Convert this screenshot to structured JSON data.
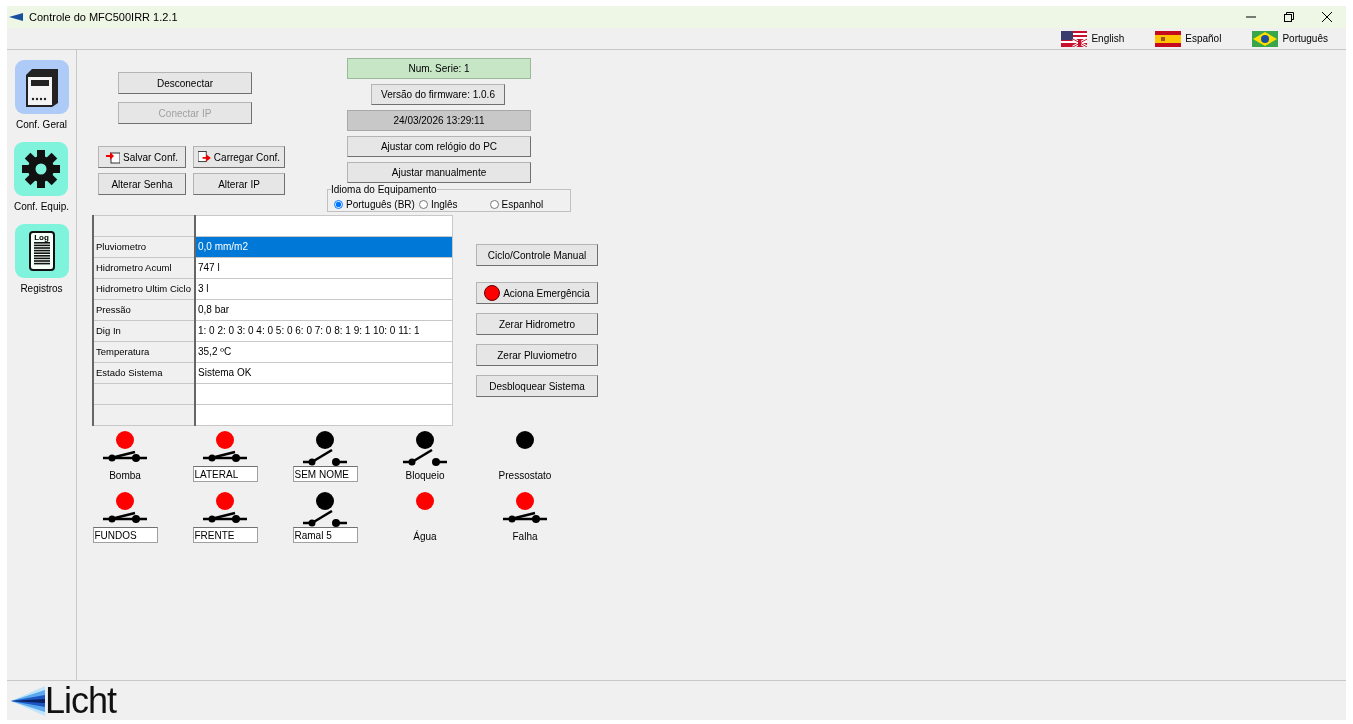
{
  "window": {
    "title": "Controle do MFC500IRR  1.2.1"
  },
  "languages": [
    {
      "kind": "us-uk",
      "label": "English"
    },
    {
      "kind": "es",
      "label": "Español"
    },
    {
      "kind": "br",
      "label": "Português"
    }
  ],
  "sidebar": {
    "items": [
      {
        "kind": "device",
        "label": "Conf. Geral",
        "selected": true
      },
      {
        "kind": "gear",
        "label": "Conf. Equip.",
        "selected": false
      },
      {
        "kind": "log",
        "label": "Registros",
        "selected": false,
        "icon_text": "Log"
      }
    ]
  },
  "connection_buttons": [
    {
      "label": "Desconectar",
      "disabled": false
    },
    {
      "label": "Conectar IP",
      "disabled": true
    }
  ],
  "config_buttons": [
    {
      "label": "Salvar Conf.",
      "kind": "save"
    },
    {
      "label": "Carregar Conf.",
      "kind": "load"
    },
    {
      "label": "Alterar Senha",
      "kind": "plain"
    },
    {
      "label": "Alterar IP",
      "kind": "plain"
    }
  ],
  "device_info": [
    {
      "kind": "serial",
      "text": "Num. Serie: 1"
    },
    {
      "kind": "firmware",
      "text": "Versão do firmware: 1.0.6"
    },
    {
      "kind": "clock",
      "text": "24/03/2026 13:29:11"
    },
    {
      "kind": "button",
      "text": "Ajustar com relógio do PC"
    },
    {
      "kind": "button",
      "text": "Ajustar manualmente"
    }
  ],
  "equipment_language": {
    "title": "Idioma do Equipamento",
    "options": [
      {
        "label": "Português (BR)",
        "selected": true
      },
      {
        "label": "Inglês",
        "selected": false
      },
      {
        "label": "Espanhol",
        "selected": false
      }
    ]
  },
  "table": {
    "rows": [
      {
        "name": "Pluviometro",
        "value": "0,0 mm/m2",
        "selected": true
      },
      {
        "name": "Hidrometro Acuml",
        "value": "747 l",
        "selected": false
      },
      {
        "name": "Hidrometro Ultim Ciclo",
        "value": "3 l",
        "selected": false
      },
      {
        "name": "Pressão",
        "value": "0,8 bar",
        "selected": false
      },
      {
        "name": "Dig In",
        "value": "1: 0  2: 0  3: 0  4: 0  5: 0  6: 0  7: 0  8: 1  9: 1  10: 0  11: 1",
        "selected": false
      },
      {
        "name": "Temperatura",
        "value": "35,2 ºC",
        "selected": false
      },
      {
        "name": "Estado Sistema",
        "value": "Sistema OK",
        "selected": false
      },
      {
        "name": "",
        "value": "",
        "selected": false
      },
      {
        "name": "",
        "value": "",
        "selected": false
      }
    ]
  },
  "action_buttons": [
    {
      "label": "Ciclo/Controle Manual",
      "indicator": false
    },
    {
      "label": "Aciona Emergência",
      "indicator": true
    },
    {
      "label": "Zerar Hidrometro",
      "indicator": false
    },
    {
      "label": "Zerar Pluviometro",
      "indicator": false
    },
    {
      "label": "Desbloquear Sistema",
      "indicator": false
    }
  ],
  "io_rows": [
    [
      {
        "color": "#ff0000",
        "switch_closed": true,
        "label": "Bomba"
      },
      {
        "color": "#ff0000",
        "switch_closed": true,
        "field_value": "LATERAL"
      },
      {
        "color": "#000000",
        "switch_closed": false,
        "field_value": "SEM NOME"
      },
      {
        "color": "#000000",
        "switch_closed": false,
        "label": "Bloqueio"
      },
      {
        "color": "#000000",
        "label": "Pressostato"
      }
    ],
    [
      {
        "color": "#ff0000",
        "switch_closed": true,
        "field_value": "FUNDOS"
      },
      {
        "color": "#ff0000",
        "switch_closed": true,
        "field_value": "FRENTE"
      },
      {
        "color": "#000000",
        "switch_closed": false,
        "field_value": "Ramal 5"
      },
      {
        "color": "#ff0000",
        "label": "Água"
      },
      {
        "color": "#ff0000",
        "switch_closed": true,
        "label": "Falha"
      }
    ]
  ],
  "footer": {
    "logo_text": "Licht"
  }
}
